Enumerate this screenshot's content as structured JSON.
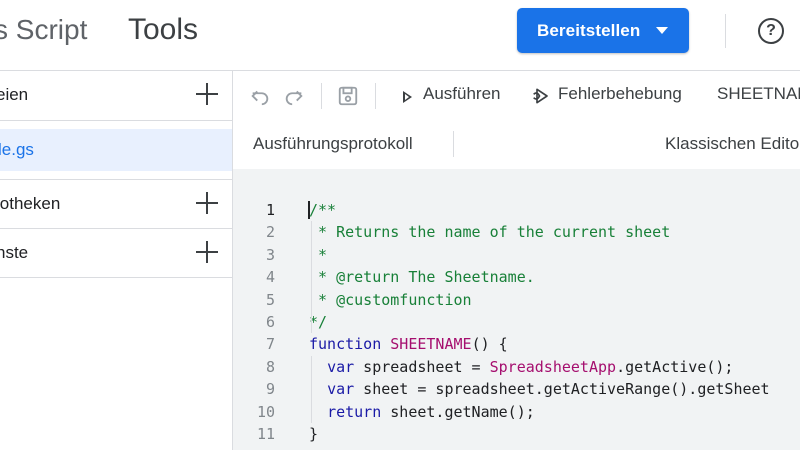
{
  "header": {
    "app_title": "s Script",
    "page_title": "Tools",
    "deploy_label": "Bereitstellen",
    "help_icon": "?"
  },
  "sidebar": {
    "files_label": "eien",
    "active_file": "le.gs",
    "libraries_label": "iotheken",
    "services_label": "nste"
  },
  "toolbar": {
    "undo_icon": "undo-icon",
    "redo_icon": "redo-icon",
    "save_icon": "save-icon",
    "run_label": "Ausführen",
    "debug_label": "Fehlerbehebung",
    "function_select": "SHEETNAME"
  },
  "subbar": {
    "log_label": "Ausführungsprotokoll",
    "classic_label": "Klassischen Edito"
  },
  "editor": {
    "active_line": 1,
    "lines": [
      {
        "n": "1",
        "tokens": [
          {
            "t": "/**",
            "c": "cm"
          }
        ]
      },
      {
        "n": "2",
        "tokens": [
          {
            "t": " * Returns the name of the current sheet",
            "c": "cm"
          }
        ]
      },
      {
        "n": "3",
        "tokens": [
          {
            "t": " *",
            "c": "cm"
          }
        ]
      },
      {
        "n": "4",
        "tokens": [
          {
            "t": " * @return The Sheetname.",
            "c": "cm"
          }
        ]
      },
      {
        "n": "5",
        "tokens": [
          {
            "t": " * @customfunction",
            "c": "cm"
          }
        ]
      },
      {
        "n": "6",
        "tokens": [
          {
            "t": "*/",
            "c": "cm"
          }
        ]
      },
      {
        "n": "7",
        "tokens": [
          {
            "t": "function",
            "c": "kw"
          },
          {
            "t": " ",
            "c": ""
          },
          {
            "t": "SHEETNAME",
            "c": "fn"
          },
          {
            "t": "() {",
            "c": ""
          }
        ]
      },
      {
        "n": "8",
        "tokens": [
          {
            "t": "  ",
            "c": ""
          },
          {
            "t": "var",
            "c": "kw"
          },
          {
            "t": " spreadsheet = ",
            "c": ""
          },
          {
            "t": "SpreadsheetApp",
            "c": "cls"
          },
          {
            "t": ".getActive();",
            "c": ""
          }
        ]
      },
      {
        "n": "9",
        "tokens": [
          {
            "t": "  ",
            "c": ""
          },
          {
            "t": "var",
            "c": "kw"
          },
          {
            "t": " sheet = spreadsheet.getActiveRange().getSheet",
            "c": ""
          }
        ]
      },
      {
        "n": "10",
        "tokens": [
          {
            "t": "  ",
            "c": ""
          },
          {
            "t": "return",
            "c": "kw"
          },
          {
            "t": " sheet.getName();",
            "c": ""
          }
        ]
      },
      {
        "n": "11",
        "tokens": [
          {
            "t": "}",
            "c": ""
          }
        ]
      }
    ]
  },
  "colors": {
    "accent": "#1a73e8",
    "comment": "#188038",
    "keyword": "#1a1aa6",
    "function": "#a50e6e"
  }
}
